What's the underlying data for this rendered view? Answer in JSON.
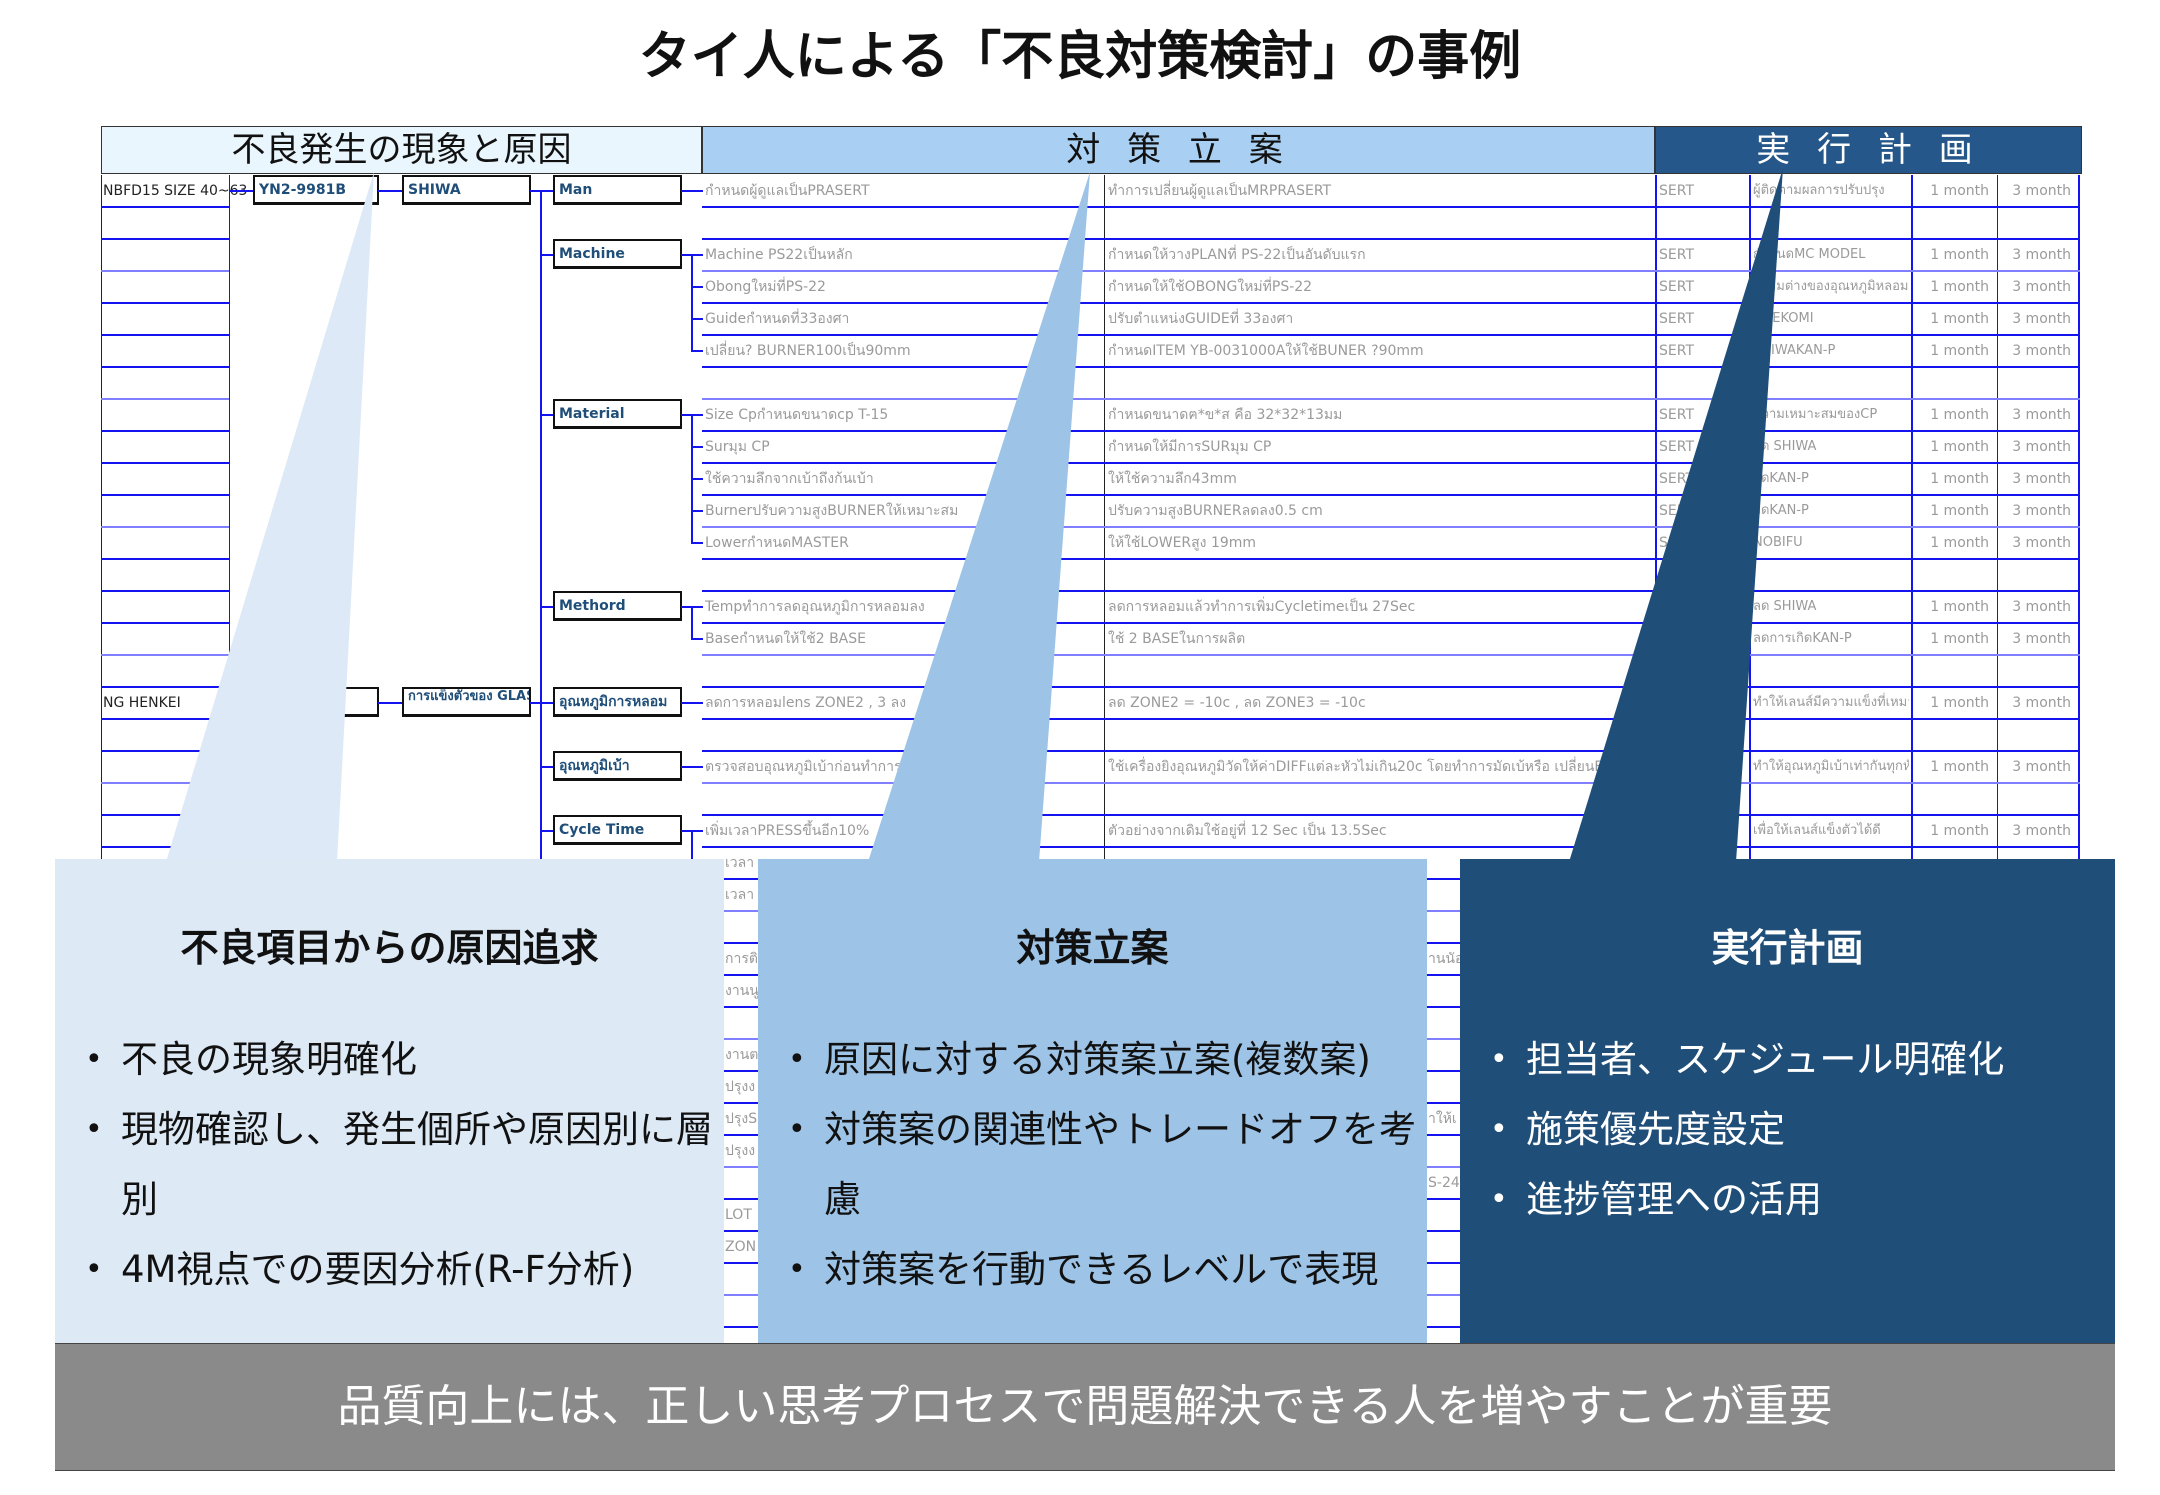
{
  "title": "タイ人による「不良対策検討」の事例",
  "table": {
    "headers": [
      "不良発生の現象と原因",
      "対 策 立 案",
      "実 行 計 画"
    ],
    "tree": {
      "groups": [
        {
          "label": "NBFD15  SIZE 40~63",
          "part": "YN2-9981B",
          "defect": "SHIWA",
          "row": 0
        },
        {
          "label": "NG HENKEI",
          "part": "]",
          "defect": "การแข็งตัวของ GLASS",
          "row": 16
        }
      ],
      "factors": [
        {
          "label": "Man",
          "row": 0,
          "last": 0
        },
        {
          "label": "Machine",
          "row": 2,
          "last": 5
        },
        {
          "label": "Material",
          "row": 7,
          "last": 11
        },
        {
          "label": "Methord",
          "row": 13,
          "last": 14
        },
        {
          "label": "อุณหภูมิการหลอม",
          "row": 16,
          "last": 16
        },
        {
          "label": "อุณหภูมิเบ้า",
          "row": 18,
          "last": 18
        },
        {
          "label": "Cycle Time",
          "row": 20,
          "last": 22
        }
      ]
    },
    "rows": [
      {
        "cause": "กำหนดผู้ดูแลเป็นPRASERT",
        "measure": "ทำการเปลี่ยนผู้ดูแลเป็นMRPRASERT",
        "owner": "SERT",
        "follow": "ผู้ติดตามผลการปรับปรุง",
        "t1": "1 month",
        "t2": "3 month"
      },
      {
        "cause": "",
        "measure": "",
        "owner": "",
        "follow": "",
        "t1": "",
        "t2": ""
      },
      {
        "cause": "Machine PS22เป็นหลัก",
        "measure": "กำหนดให้วางPLANที่ PS-22เป็นอันดับแรก",
        "owner": "SERT",
        "follow": "กำหนดMC MODEL",
        "t1": "1 month",
        "t2": "3 month"
      },
      {
        "cause": "Obongใหม่ที่PS-22",
        "measure": "กำหนดให้ใช้OBONGใหม่ที่PS-22",
        "owner": "SERT",
        "follow": "ความต่างของอุณหภูมิหลอม",
        "t1": "1 month",
        "t2": "3 month"
      },
      {
        "cause": "Guideกำหนดที่33องศา",
        "measure": "ปรับตำแหน่งGUIDEที่ 33องศา",
        "owner": "SERT",
        "follow": "OREKOMI",
        "t1": "1 month",
        "t2": "3 month"
      },
      {
        "cause": "เปลี่ยน? BURNER100เป็น90mm",
        "measure": "กำหนดITEM YB-0031000Aให้ใช้BUNER ?90mm",
        "owner": "SERT",
        "follow": "SHIWAKAN-P",
        "t1": "1 month",
        "t2": "3 month"
      },
      {
        "cause": "",
        "measure": "",
        "owner": "",
        "follow": "",
        "t1": "",
        "t2": ""
      },
      {
        "cause": "Size Cpกำหนดขนาดcp T-15",
        "measure": "กำหนดขนาดฅ*ข*ส คือ 32*32*13มม",
        "owner": "SERT",
        "follow": "ความเหมาะสมของCP",
        "t1": "1 month",
        "t2": "3 month"
      },
      {
        "cause": "Surมุม CP",
        "measure": "กำหนดให้มีการSURมุม CP",
        "owner": "SERT",
        "follow": "ลด SHIWA",
        "t1": "1 month",
        "t2": "3 month"
      },
      {
        "cause": "ใช้ความลึกจากเบ้าถึงก้นเบ้า",
        "measure": "ให้ใช้ความลึก43mm",
        "owner": "SERT",
        "follow": "ลดKAN-P",
        "t1": "1 month",
        "t2": "3 month"
      },
      {
        "cause": "BurnerปรับความสูงBURNERให้เหมาะสม",
        "measure": "ปรับความสูงBURNERลดลง0.5 cm",
        "owner": "SERT",
        "follow": "ลดKAN-P",
        "t1": "1 month",
        "t2": "3 month"
      },
      {
        "cause": "LowerกำหนดMASTER",
        "measure": "ให้ใช้LOWERสูง 19mm",
        "owner": "SERT",
        "follow": "NOBIFU",
        "t1": "1 month",
        "t2": "3 month"
      },
      {
        "cause": "",
        "measure": "",
        "owner": "",
        "follow": "",
        "t1": "",
        "t2": ""
      },
      {
        "cause": "Tempทำการลดอุณหภูมิการหลอมลง",
        "measure": "ลดการหลอมแล้วทำการเพิ่มCycletimeเป็น 27Sec",
        "owner": "",
        "follow": "ลด SHIWA",
        "t1": "1 month",
        "t2": "3 month"
      },
      {
        "cause": "Baseกำหนดให้ใช้2 BASE",
        "measure": "ใช้ 2 BASEในการผลิต",
        "owner": "",
        "follow": "ลดการเกิดKAN-P",
        "t1": "1 month",
        "t2": "3 month"
      },
      {
        "cause": "",
        "measure": "",
        "owner": "",
        "follow": "",
        "t1": "",
        "t2": ""
      },
      {
        "cause": "ลดการหลอมlens ZONE2 , 3 ลง",
        "measure": "ลด ZONE2 = -10c , ลด ZONE3 = -10c",
        "owner": "",
        "follow": "ทำให้เลนส์มีความแข็งที่เหมาะสม",
        "t1": "1 month",
        "t2": "3 month"
      },
      {
        "cause": "",
        "measure": "",
        "owner": "",
        "follow": "",
        "t1": "",
        "t2": ""
      },
      {
        "cause": "ตรวจสอบอุณหภูมิเบ้าก่อนทำการผลิต",
        "measure": "ใช้เครื่องยิงอุณหภูมิวัดให้ค่าDIFFแต่ละหัวไม่เกิน20c โดยทำการมัดเบ้หรือ เปลี่ยนBURNER",
        "owner": "",
        "follow": "ทำให้อุณหภูมิเบ้าเท่ากันทุกหัว",
        "t1": "1 month",
        "t2": "3 month"
      },
      {
        "cause": "",
        "measure": "",
        "owner": "",
        "follow": "",
        "t1": "",
        "t2": ""
      },
      {
        "cause": "เพิ่มเวลาPRESSขึ้นอีก10%",
        "measure": "ตัวอย่างจากเดิมใช้อยู่ที่ 12 Sec เป็น 13.5Sec",
        "owner": "",
        "follow": "เพื่อให้เลนส์แข็งตัวได้ดี",
        "t1": "1 month",
        "t2": "3 month"
      },
      {
        "cause": "เวลา",
        "measure": "",
        "owner": "",
        "follow": "",
        "t1": "",
        "t2": ""
      },
      {
        "cause": "เวลา",
        "measure": "",
        "owner": "",
        "follow": "",
        "t1": "",
        "t2": ""
      },
      {
        "cause": "",
        "measure": "",
        "owner": "",
        "follow": "",
        "t1": "",
        "t2": ""
      },
      {
        "cause": "การติด",
        "measure": "านนัอ",
        "owner": "",
        "follow": "",
        "t1": "",
        "t2": ""
      },
      {
        "cause": "งานนู",
        "measure": "",
        "owner": "",
        "follow": "",
        "t1": "",
        "t2": ""
      },
      {
        "cause": "",
        "measure": "",
        "owner": "",
        "follow": "",
        "t1": "",
        "t2": ""
      },
      {
        "cause": "งานต",
        "measure": "",
        "owner": "",
        "follow": "",
        "t1": "",
        "t2": ""
      },
      {
        "cause": "ปรุงง",
        "measure": "",
        "owner": "",
        "follow": "",
        "t1": "",
        "t2": ""
      },
      {
        "cause": "ปรุงS",
        "measure": "าให้เ",
        "owner": "",
        "follow": "",
        "t1": "",
        "t2": ""
      },
      {
        "cause": "ปรุงง",
        "measure": "",
        "owner": "",
        "follow": "",
        "t1": "",
        "t2": ""
      },
      {
        "cause": "",
        "measure": "S-24",
        "owner": "",
        "follow": "",
        "t1": "",
        "t2": ""
      },
      {
        "cause": "LOT",
        "measure": "",
        "owner": "",
        "follow": "",
        "t1": "",
        "t2": ""
      },
      {
        "cause": "ZON",
        "measure": "",
        "owner": "",
        "follow": "",
        "t1": "",
        "t2": ""
      },
      {
        "cause": "",
        "measure": "",
        "owner": "",
        "follow": "",
        "t1": "",
        "t2": ""
      },
      {
        "cause": "",
        "measure": "",
        "owner": "",
        "follow": "",
        "t1": "",
        "t2": ""
      }
    ]
  },
  "panels": [
    {
      "title": "不良項目からの原因追求",
      "bullets": [
        "不良の現象明確化",
        "現物確認し、発生個所や原因別に層別",
        "4M視点での要因分析(R-F分析)"
      ]
    },
    {
      "title": "対策立案",
      "bullets": [
        "原因に対する対策案立案(複数案)",
        "対策案の関連性やトレードオフを考慮",
        "対策案を行動できるレベルで表現"
      ]
    },
    {
      "title": "実行計画",
      "bullets": [
        "担当者、スケジュール明確化",
        "施策優先度設定",
        "進捗管理への活用"
      ]
    }
  ],
  "conclusion": "品質向上には、正しい思考プロセスで問題解決できる人を増やすことが重要",
  "colors": {
    "panel1": "#ddeaf6",
    "panel2": "#9dc3e6",
    "panel3": "#1f4e79",
    "band": "#8a8a8a",
    "grid": "#1414f0"
  }
}
